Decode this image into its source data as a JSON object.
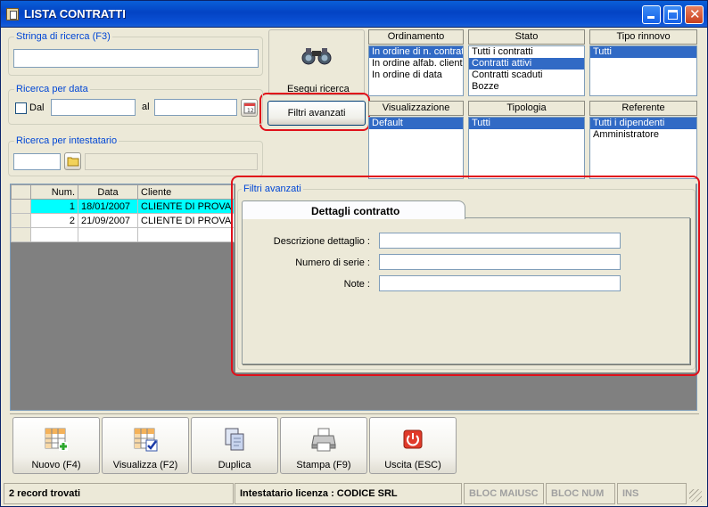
{
  "window": {
    "title": "LISTA CONTRATTI"
  },
  "search": {
    "group_label": "Stringa di ricerca (F3)",
    "value": "",
    "execute_label": "Esegui ricerca",
    "advanced_label": "Filtri avanzati"
  },
  "date_search": {
    "group_label": "Ricerca per data",
    "from_label": "Dal",
    "to_label": "al",
    "from_value": "",
    "to_value": ""
  },
  "holder_search": {
    "group_label": "Ricerca per intestatario",
    "code_value": "",
    "name_value": ""
  },
  "filters": {
    "ordinamento": {
      "header": "Ordinamento",
      "items": [
        "In ordine di n. contratto",
        "In ordine alfab. cliente",
        "In ordine di data"
      ],
      "selected": 0
    },
    "stato": {
      "header": "Stato",
      "items": [
        "Tutti i contratti",
        "Contratti attivi",
        "Contratti scaduti",
        "Bozze"
      ],
      "selected": 1
    },
    "tipo_rinnovo": {
      "header": "Tipo rinnovo",
      "items": [
        "Tutti"
      ],
      "selected": 0
    },
    "visualizzazione": {
      "header": "Visualizzazione",
      "items": [
        "Default"
      ],
      "selected": 0
    },
    "tipologia": {
      "header": "Tipologia",
      "items": [
        "Tutti"
      ],
      "selected": 0
    },
    "referente": {
      "header": "Referente",
      "items": [
        "Tutti i dipendenti",
        "Amministratore"
      ],
      "selected": 0
    }
  },
  "grid": {
    "columns": [
      "Num.",
      "Data",
      "Cliente"
    ],
    "rows": [
      {
        "num": "1",
        "date": "18/01/2007",
        "client": "CLIENTE DI PROVA"
      },
      {
        "num": "2",
        "date": "21/09/2007",
        "client": "CLIENTE DI PROVA"
      }
    ]
  },
  "advanced": {
    "group_label": "Filtri avanzati",
    "tab_label": "Dettagli contratto",
    "fields": [
      {
        "label": "Descrizione dettaglio :",
        "value": ""
      },
      {
        "label": "Numero di serie :",
        "value": ""
      },
      {
        "label": "Note :",
        "value": ""
      }
    ]
  },
  "toolbar": {
    "new_label": "Nuovo (F4)",
    "view_label": "Visualizza (F2)",
    "duplicate_label": "Duplica",
    "print_label": "Stampa (F9)",
    "exit_label": "Uscita (ESC)"
  },
  "status": {
    "records": "2 record trovati",
    "license": "Intestatario licenza : CODICE SRL",
    "caps": "BLOC MAIUSC",
    "num": "BLOC NUM",
    "ins": "INS"
  }
}
